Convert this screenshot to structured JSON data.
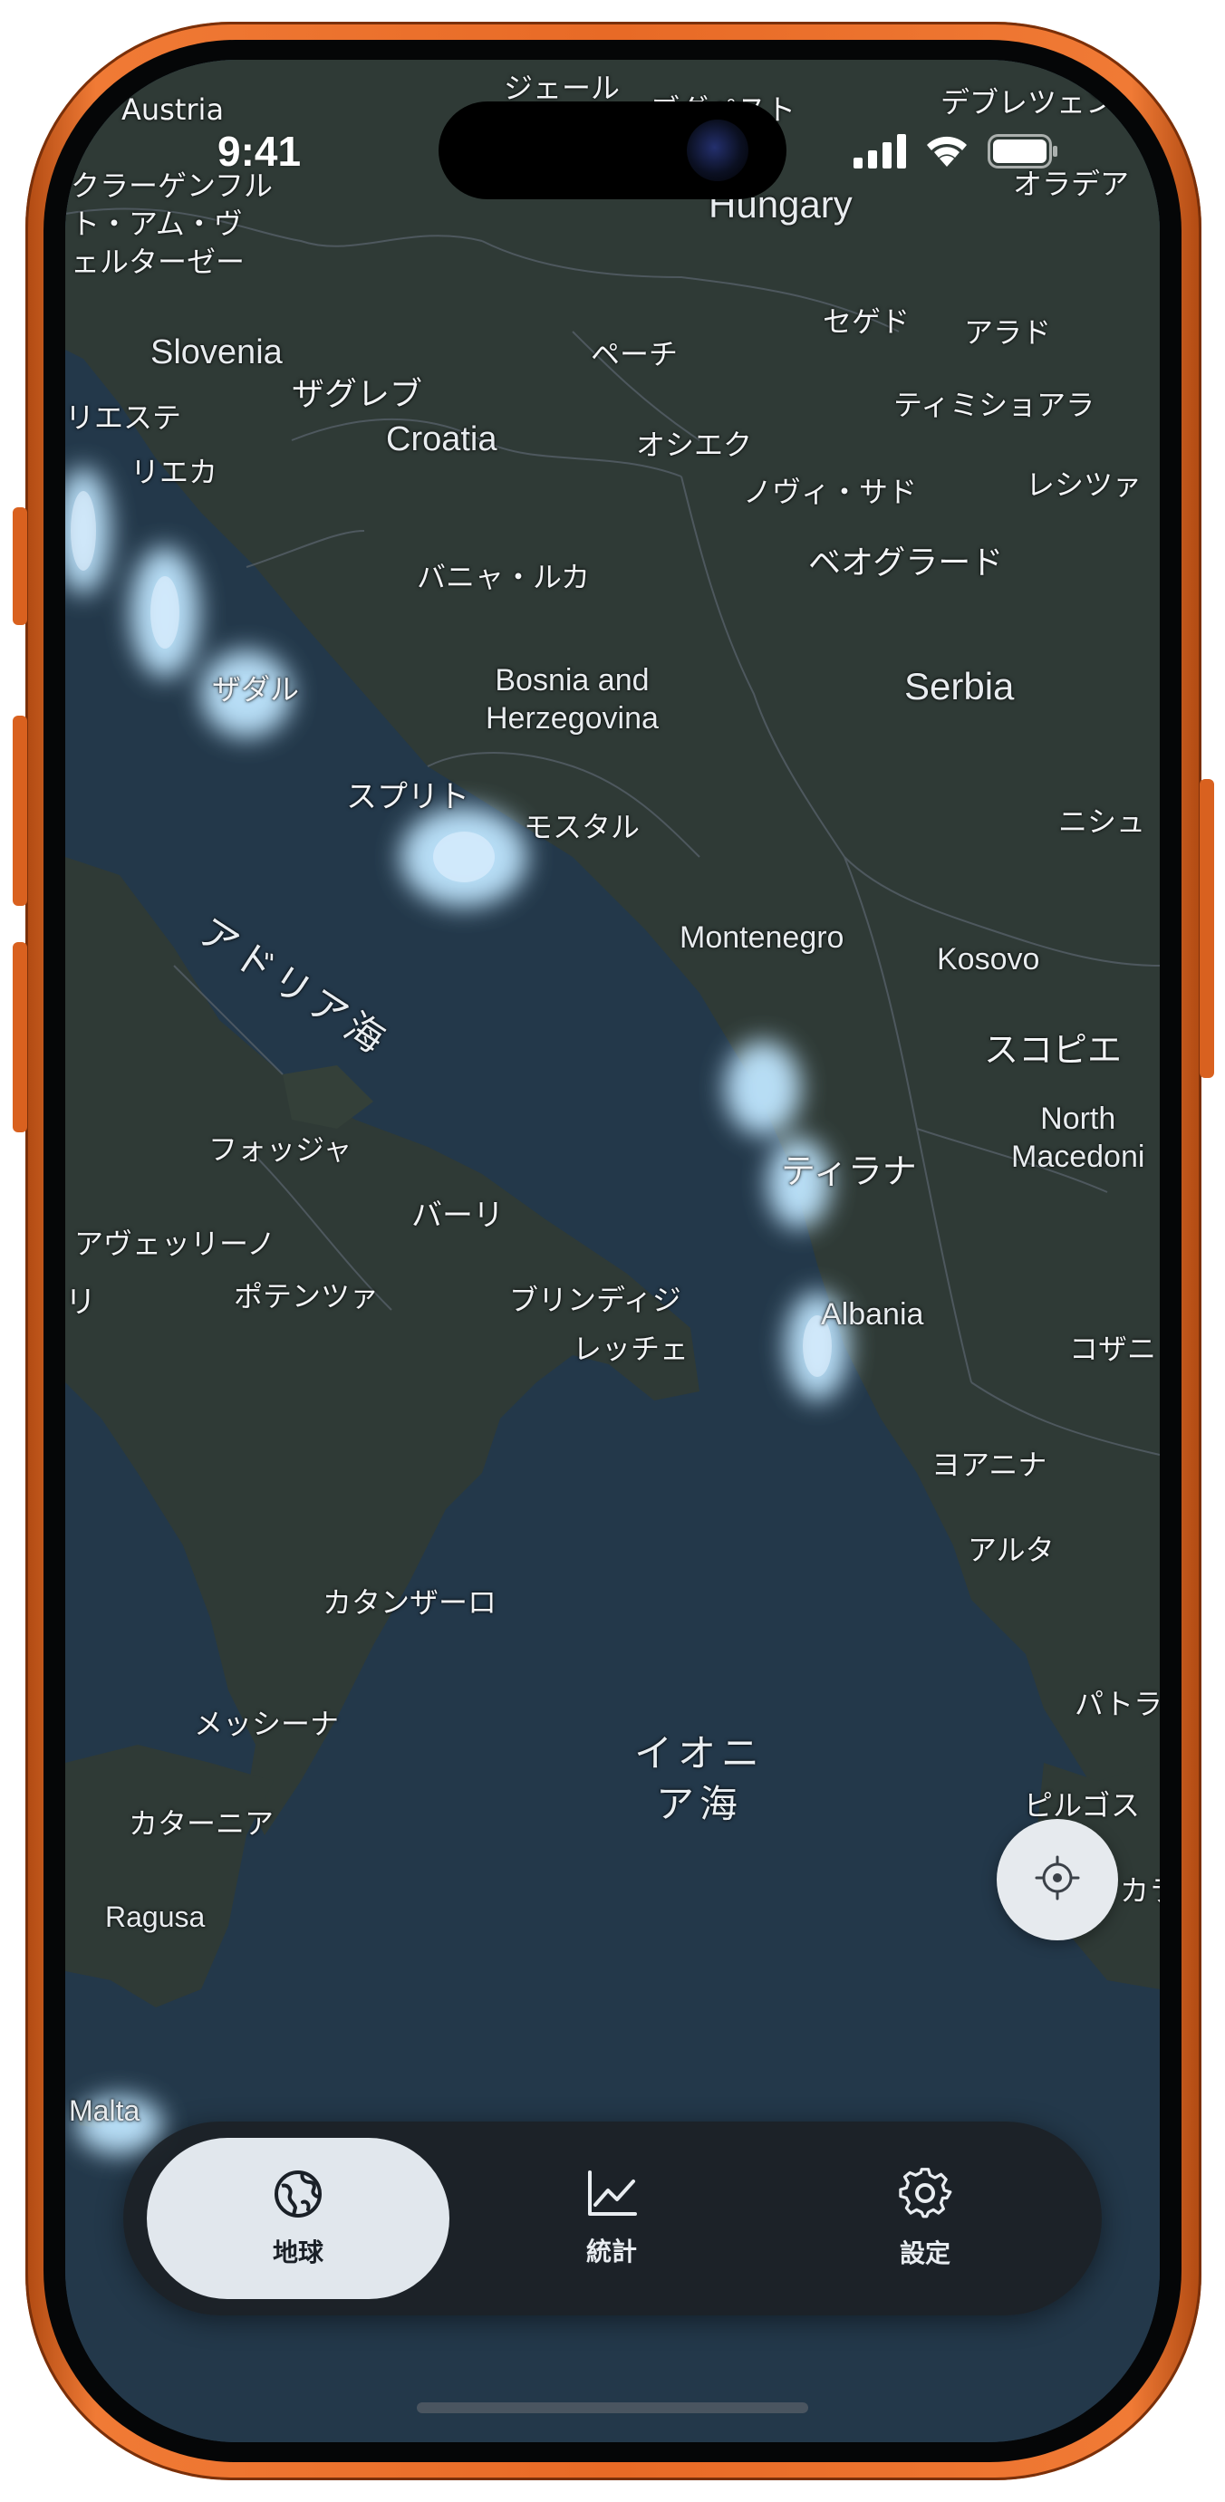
{
  "status_bar": {
    "time": "9:41"
  },
  "map": {
    "labels": {
      "austria": "Austria",
      "klagenfurt": "クラーゲンフル\nト・アム・ヴ\nェルターゼー",
      "slovenia": "Slovenia",
      "zagreb": "ザグレブ",
      "trieste": "リエステ",
      "croatia": "Croatia",
      "rijeka": "リエカ",
      "gyor": "ジェール",
      "budapest": "ブダペスト",
      "debrecen": "デブレツェン",
      "oradea": "オラデア",
      "hungary": "Hungary",
      "pecs": "ペーチ",
      "szeged": "セゲド",
      "arad": "アラド",
      "timisoara": "ティミショアラ",
      "osijek": "オシエク",
      "novi_sad": "ノヴィ・サド",
      "resita": "レシツァ",
      "banja_luka": "バニャ・ルカ",
      "belgrade": "ベオグラード",
      "zadar": "ザダル",
      "bosnia": "Bosnia and\nHerzegovina",
      "serbia": "Serbia",
      "split": "スプリト",
      "mostar": "モスタル",
      "nis": "ニシュ",
      "adriatic_sea": "アドリア海",
      "montenegro": "Montenegro",
      "kosovo": "Kosovo",
      "skopje": "スコピエ",
      "north_macedonia": "North\nMacedoni",
      "tirana": "ティラナ",
      "foggia": "フォッジャ",
      "bari": "バーリ",
      "avellino": "アヴェッリーノ",
      "napoli_partial": "リ",
      "potenza": "ポテンツァ",
      "brindisi": "ブリンディジ",
      "lecce": "レッチェ",
      "albania": "Albania",
      "kozani": "コザニ",
      "ioannina": "ヨアニナ",
      "arta": "アルタ",
      "catanzaro": "カタンザーロ",
      "messina": "メッシーナ",
      "ionian_sea": "イオニ\nア海",
      "patras": "パトラ",
      "pyrgos": "ピルゴス",
      "catania": "カターニア",
      "kalamata_partial": "カラ",
      "ragusa": "Ragusa",
      "malta": "Malta"
    }
  },
  "locate_button": {
    "icon": "crosshair-icon"
  },
  "tab_bar": {
    "tabs": [
      {
        "label": "地球",
        "icon": "globe-icon",
        "active": true
      },
      {
        "label": "統計",
        "icon": "chart-line-icon",
        "active": false
      },
      {
        "label": "設定",
        "icon": "gear-icon",
        "active": false
      }
    ]
  },
  "colors": {
    "phone_frame": "#e86a26",
    "sea": "#23384a",
    "land": "#2f3a36",
    "highlight_glow": "#bfe6ff",
    "tab_active_bg": "#e1e7ed",
    "tab_bar_bg": "#1c2126"
  }
}
